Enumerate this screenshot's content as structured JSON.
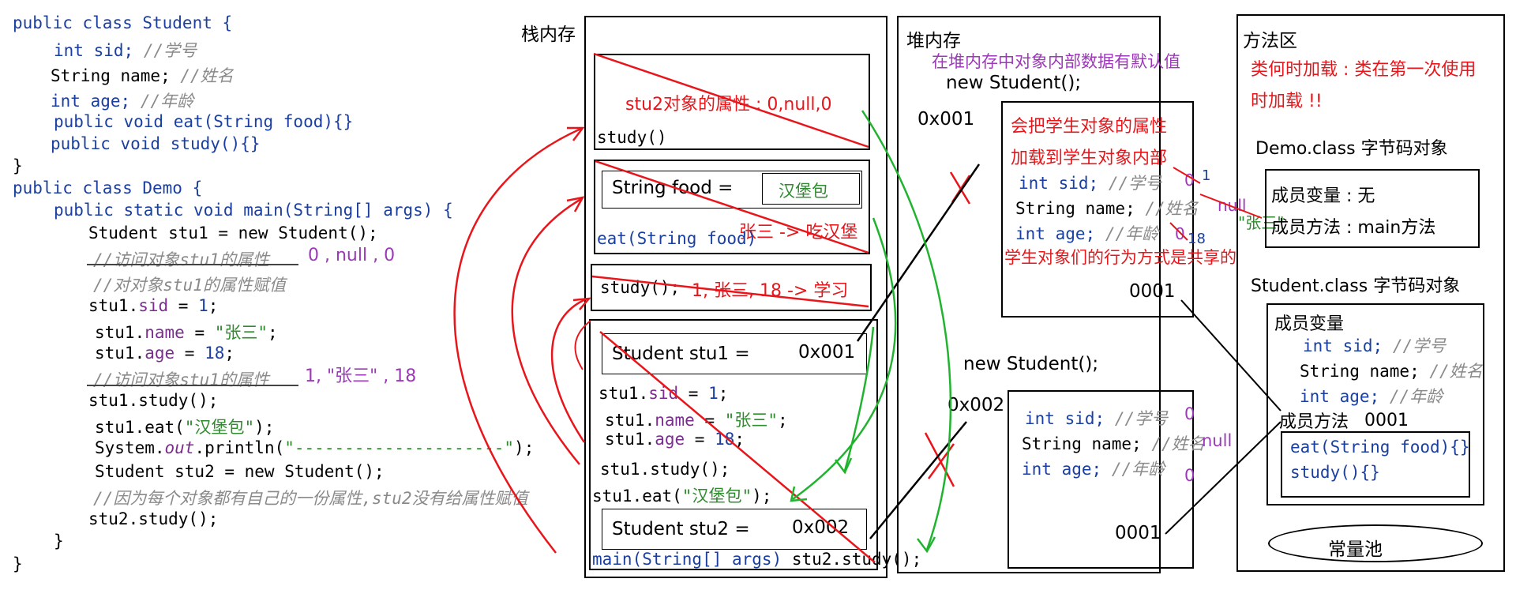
{
  "code": {
    "l1": "public class Student {",
    "l2": "int sid;",
    "l2c": "//学号",
    "l3": "String name;",
    "l3c": "//姓名",
    "l4": "int age;",
    "l4c": "//年龄",
    "l5": "public void eat(String food){}",
    "l6": "public void study(){}",
    "l7": "}",
    "l8": "public class Demo {",
    "l9": "public static void main(String[] args) {",
    "l10": "Student stu1 = new Student();",
    "l11c": "//访问对象stu1的属性",
    "l11a": "0 , null , 0",
    "l12c": "//对对象stu1的属性赋值",
    "l13a": "stu1.",
    "l13b": "sid",
    "l13c": " = ",
    "l13d": "1",
    "l13e": ";",
    "l14a": "stu1.",
    "l14b": "name",
    "l14c": " = ",
    "l14d": "\"张三\"",
    "l14e": ";",
    "l15a": "stu1.",
    "l15b": "age",
    "l15c": " = ",
    "l15d": "18",
    "l15e": ";",
    "l16c": "//访问对象stu1的属性",
    "l16a": "1, \"张三\" , 18",
    "l17": "stu1.study();",
    "l18a": "stu1.eat(",
    "l18b": "\"汉堡包\"",
    "l18c": ");",
    "l19a": "System.",
    "l19b": "out",
    "l19c": ".println(",
    "l19d": "\"---------------------\"",
    "l19e": ");",
    "l20": "Student stu2 = new Student();",
    "l21c": "//因为每个对象都有自己的一份属性,stu2没有给属性赋值",
    "l22": "stu2.study();",
    "l23": "}",
    "l24": "}"
  },
  "stack": {
    "title": "栈内存",
    "frame1_note": "stu2对象的属性 : 0,null,0",
    "frame1_label": "study()",
    "frame2_var": "String food =",
    "frame2_val": "汉堡包",
    "frame2_note": "张三 -> 吃汉堡",
    "frame2_label": "eat(String food)",
    "frame3_label": "study();",
    "frame3_note": "1, 张三, 18 -> 学习",
    "main_stu1": "Student stu1 =",
    "main_stu1_addr": "0x001",
    "main_sid_a": "stu1.",
    "main_sid_b": "sid",
    "main_sid_c": " = ",
    "main_sid_d": "1",
    "main_sid_e": ";",
    "main_name_a": "stu1.",
    "main_name_b": "name",
    "main_name_c": " = ",
    "main_name_d": "\"张三\"",
    "main_name_e": ";",
    "main_age_a": "stu1.",
    "main_age_b": "age",
    "main_age_c": " = ",
    "main_age_d": "18",
    "main_age_e": ";",
    "main_study": "stu1.study();",
    "main_eat_a": "stu1.eat(",
    "main_eat_b": "\"汉堡包\"",
    "main_eat_c": ");",
    "main_stu2": "Student stu2 =",
    "main_stu2_addr": "0x002",
    "main_label_a": "main(String[] args)",
    "main_label_b": " stu2.study();"
  },
  "heap": {
    "title": "堆内存",
    "note_default": "在堆内存中对象内部数据有默认值",
    "new1": "new Student();",
    "addr1": "0x001",
    "obj1_note1": "会把学生对象的属性",
    "obj1_note2": "加载到学生对象内部",
    "obj1_sid": "int sid;",
    "obj1_sidc": "//学号",
    "obj1_sid_old": "0",
    "obj1_sid_new": "1",
    "obj1_name": "String name;",
    "obj1_namec": "//姓名",
    "obj1_name_old": "null",
    "obj1_name_new": "\"张三\"",
    "obj1_age": "int age;",
    "obj1_agec": "//年龄",
    "obj1_age_old": "0",
    "obj1_age_new": "18",
    "obj1_note3": "学生对象们的行为方式是共享的",
    "obj1_ref": "0001",
    "new2": "new Student();",
    "addr2": "0x002",
    "obj2_sid": "int sid;",
    "obj2_sidc": "//学号",
    "obj2_sid_val": "0",
    "obj2_name": "String name;",
    "obj2_namec": "//姓名",
    "obj2_name_val": "null",
    "obj2_age": "int age;",
    "obj2_agec": "//年龄",
    "obj2_age_val": "0",
    "obj2_ref": "0001"
  },
  "method": {
    "title": "方法区",
    "note1": "类何时加载 : 类在第一次使用",
    "note2": "时加载 !!",
    "demo_title": "Demo.class 字节码对象",
    "demo_vars": "成员变量 : 无",
    "demo_methods": "成员方法 : main方法",
    "student_title": "Student.class 字节码对象",
    "vars_title": "成员变量",
    "sid": "int sid;",
    "sidc": "//学号",
    "name": "String name;",
    "namec": "//姓名",
    "age": "int age;",
    "agec": "//年龄",
    "methods_title": "成员方法",
    "methods_addr": "0001",
    "eat": "eat(String food){}",
    "study": "study(){}",
    "pool": "常量池"
  }
}
